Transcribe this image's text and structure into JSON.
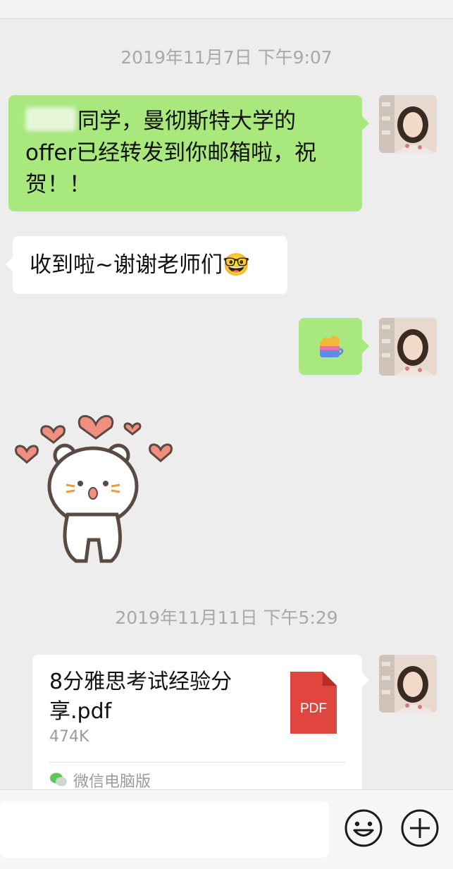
{
  "timestamps": [
    "2019年11月7日 下午9:07",
    "2019年11月11日 下午5:29"
  ],
  "messages": {
    "m1": {
      "redacted_name": "",
      "text": "同学，曼彻斯特大学的\noffer已经转发到你邮箱啦，祝贺！！"
    },
    "m2": {
      "text": "收到啦~谢谢老师们",
      "emoji": "🤓"
    },
    "m3": {
      "sticker_icon": "cake-cup-sticker-icon"
    },
    "m4": {
      "sticker_icon": "bear-with-hearts-sticker"
    },
    "file": {
      "name": "8分雅思考试经验分享.pdf",
      "size": "474K",
      "type_label": "PDF",
      "source": "微信电脑版"
    }
  },
  "colors": {
    "sent_bubble": "#a8e87c",
    "received_bubble": "#ffffff",
    "background": "#ededed",
    "pdf_icon": "#e0463e"
  },
  "icons": {
    "emoji_button": "smiley-icon",
    "plus_button": "plus-circle-icon"
  }
}
